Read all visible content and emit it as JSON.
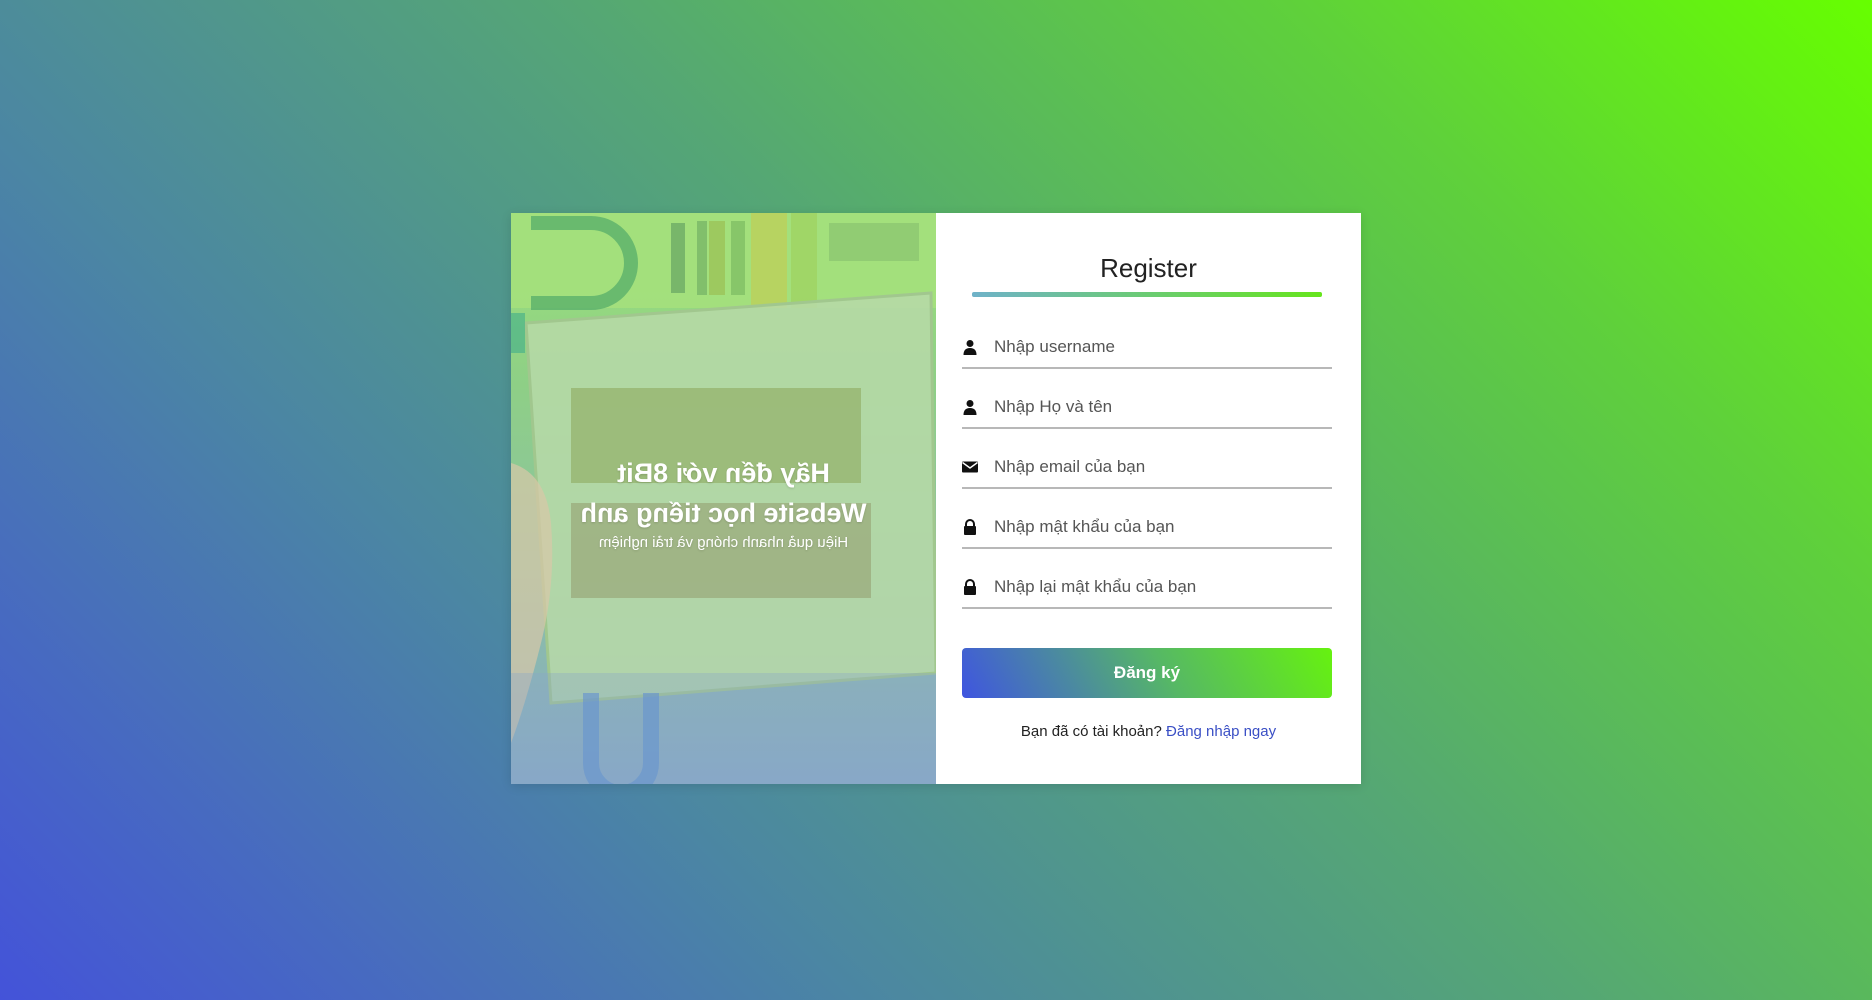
{
  "banner": {
    "line1": "Hãy đến với 8Bit",
    "line2": "Website học tiếng anh",
    "subtitle": "Hiệu quả nhanh chóng và trải nghiệm"
  },
  "form": {
    "title": "Register",
    "fields": [
      {
        "icon": "user-icon",
        "placeholder": "Nhập username",
        "value": ""
      },
      {
        "icon": "user-icon",
        "placeholder": "Nhập Họ và tên",
        "value": ""
      },
      {
        "icon": "envelope-icon",
        "placeholder": "Nhập email của bạn",
        "value": ""
      },
      {
        "icon": "lock-icon",
        "placeholder": "Nhập mật khẩu của bạn",
        "value": ""
      },
      {
        "icon": "lock-icon",
        "placeholder": "Nhập lại mật khẩu của bạn",
        "value": ""
      }
    ],
    "submit_label": "Đăng ký",
    "login_prompt": "Bạn đã có tài khoản?",
    "login_link": "Đăng nhập ngay"
  },
  "colors": {
    "accent_start": "#4453d9",
    "accent_end": "#66ff00",
    "link": "#3a4fc5"
  }
}
